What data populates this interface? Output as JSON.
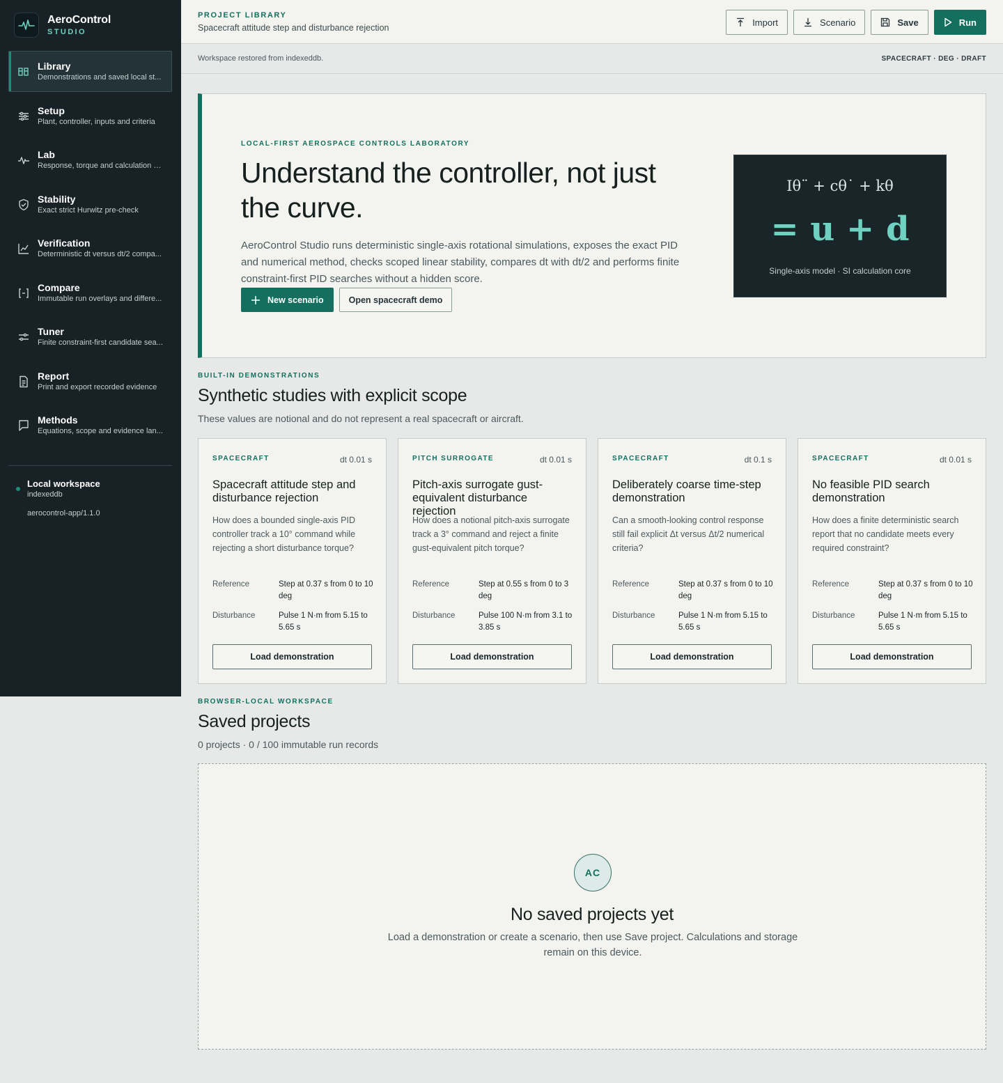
{
  "brand": {
    "name": "AeroControl",
    "sub": "STUDIO"
  },
  "nav": [
    {
      "label": "Library",
      "desc": "Demonstrations and saved local st...",
      "icon": "library-icon"
    },
    {
      "label": "Setup",
      "desc": "Plant, controller, inputs and criteria",
      "icon": "sliders-icon"
    },
    {
      "label": "Lab",
      "desc": "Response, torque and calculation e...",
      "icon": "pulse-icon"
    },
    {
      "label": "Stability",
      "desc": "Exact strict Hurwitz pre-check",
      "icon": "shield-check-icon"
    },
    {
      "label": "Verification",
      "desc": "Deterministic dt versus dt/2 compa...",
      "icon": "chart-icon"
    },
    {
      "label": "Compare",
      "desc": "Immutable run overlays and differe...",
      "icon": "compare-icon"
    },
    {
      "label": "Tuner",
      "desc": "Finite constraint-first candidate sea...",
      "icon": "tuner-icon"
    },
    {
      "label": "Report",
      "desc": "Print and export recorded evidence",
      "icon": "document-icon"
    },
    {
      "label": "Methods",
      "desc": "Equations, scope and evidence lan...",
      "icon": "comment-icon"
    }
  ],
  "workspace": {
    "title": "Local workspace",
    "storage": "indexeddb",
    "version": "aerocontrol-app/1.1.0"
  },
  "topbar": {
    "kicker": "PROJECT LIBRARY",
    "title": "Spacecraft attitude step and disturbance rejection",
    "import_label": "Import",
    "scenario_label": "Scenario",
    "save_label": "Save",
    "run_label": "Run"
  },
  "status": {
    "message": "Workspace restored from indexeddb.",
    "tags": "SPACECRAFT · DEG · DRAFT"
  },
  "hero": {
    "kicker": "LOCAL-FIRST AEROSPACE CONTROLS LABORATORY",
    "title": "Understand the controller, not just the curve.",
    "body": "AeroControl Studio runs deterministic single-axis rotational simulations, exposes the exact PID and numerical method, checks scoped linear stability, compares dt with dt/2 and performs finite constraint-first PID searches without a hidden score.",
    "new_scenario_label": "New scenario",
    "open_demo_label": "Open spacecraft demo",
    "equation_line1": "Iθ¨ + cθ˙ + kθ",
    "equation_line2": "= u + d",
    "equation_caption": "Single-axis model · SI calculation core"
  },
  "demos": {
    "kicker": "BUILT-IN DEMONSTRATIONS",
    "title": "Synthetic studies with explicit scope",
    "subtitle": "These values are notional and do not represent a real spacecraft or aircraft.",
    "reference_label": "Reference",
    "disturbance_label": "Disturbance",
    "load_label": "Load demonstration",
    "cards": [
      {
        "kind": "SPACECRAFT",
        "dt": "dt 0.01 s",
        "title": "Spacecraft attitude step and disturbance rejection",
        "question": "How does a bounded single-axis PID controller track a 10° command while rejecting a short disturbance torque?",
        "reference": "Step at 0.37 s from 0 to 10 deg",
        "disturbance": "Pulse 1 N·m from 5.15 to 5.65 s"
      },
      {
        "kind": "PITCH SURROGATE",
        "dt": "dt 0.01 s",
        "title": "Pitch-axis surrogate gust-equivalent disturbance rejection",
        "question": "How does a notional pitch-axis surrogate track a 3° command and reject a finite gust-equivalent pitch torque?",
        "reference": "Step at 0.55 s from 0 to 3 deg",
        "disturbance": "Pulse 100 N·m from 3.1 to 3.85 s"
      },
      {
        "kind": "SPACECRAFT",
        "dt": "dt 0.1 s",
        "title": "Deliberately coarse time-step demonstration",
        "question": "Can a smooth-looking control response still fail explicit Δt versus Δt/2 numerical criteria?",
        "reference": "Step at 0.37 s from 0 to 10 deg",
        "disturbance": "Pulse 1 N·m from 5.15 to 5.65 s"
      },
      {
        "kind": "SPACECRAFT",
        "dt": "dt 0.01 s",
        "title": "No feasible PID search demonstration",
        "question": "How does a finite deterministic search report that no candidate meets every required constraint?",
        "reference": "Step at 0.37 s from 0 to 10 deg",
        "disturbance": "Pulse 1 N·m from 5.15 to 5.65 s"
      }
    ]
  },
  "saved": {
    "kicker": "BROWSER-LOCAL WORKSPACE",
    "title": "Saved projects",
    "subtitle": "0 projects · 0 / 100 immutable run records",
    "badge": "AC",
    "empty_title": "No saved projects yet",
    "empty_body": "Load a demonstration or create a scenario, then use Save project. Calculations and storage remain on this device."
  },
  "colors": {
    "accent": "#146f5f",
    "accent_light": "#6fd1bf",
    "sidebar": "#172126",
    "page": "#e6e9e7",
    "panel": "#f3f4f0"
  }
}
